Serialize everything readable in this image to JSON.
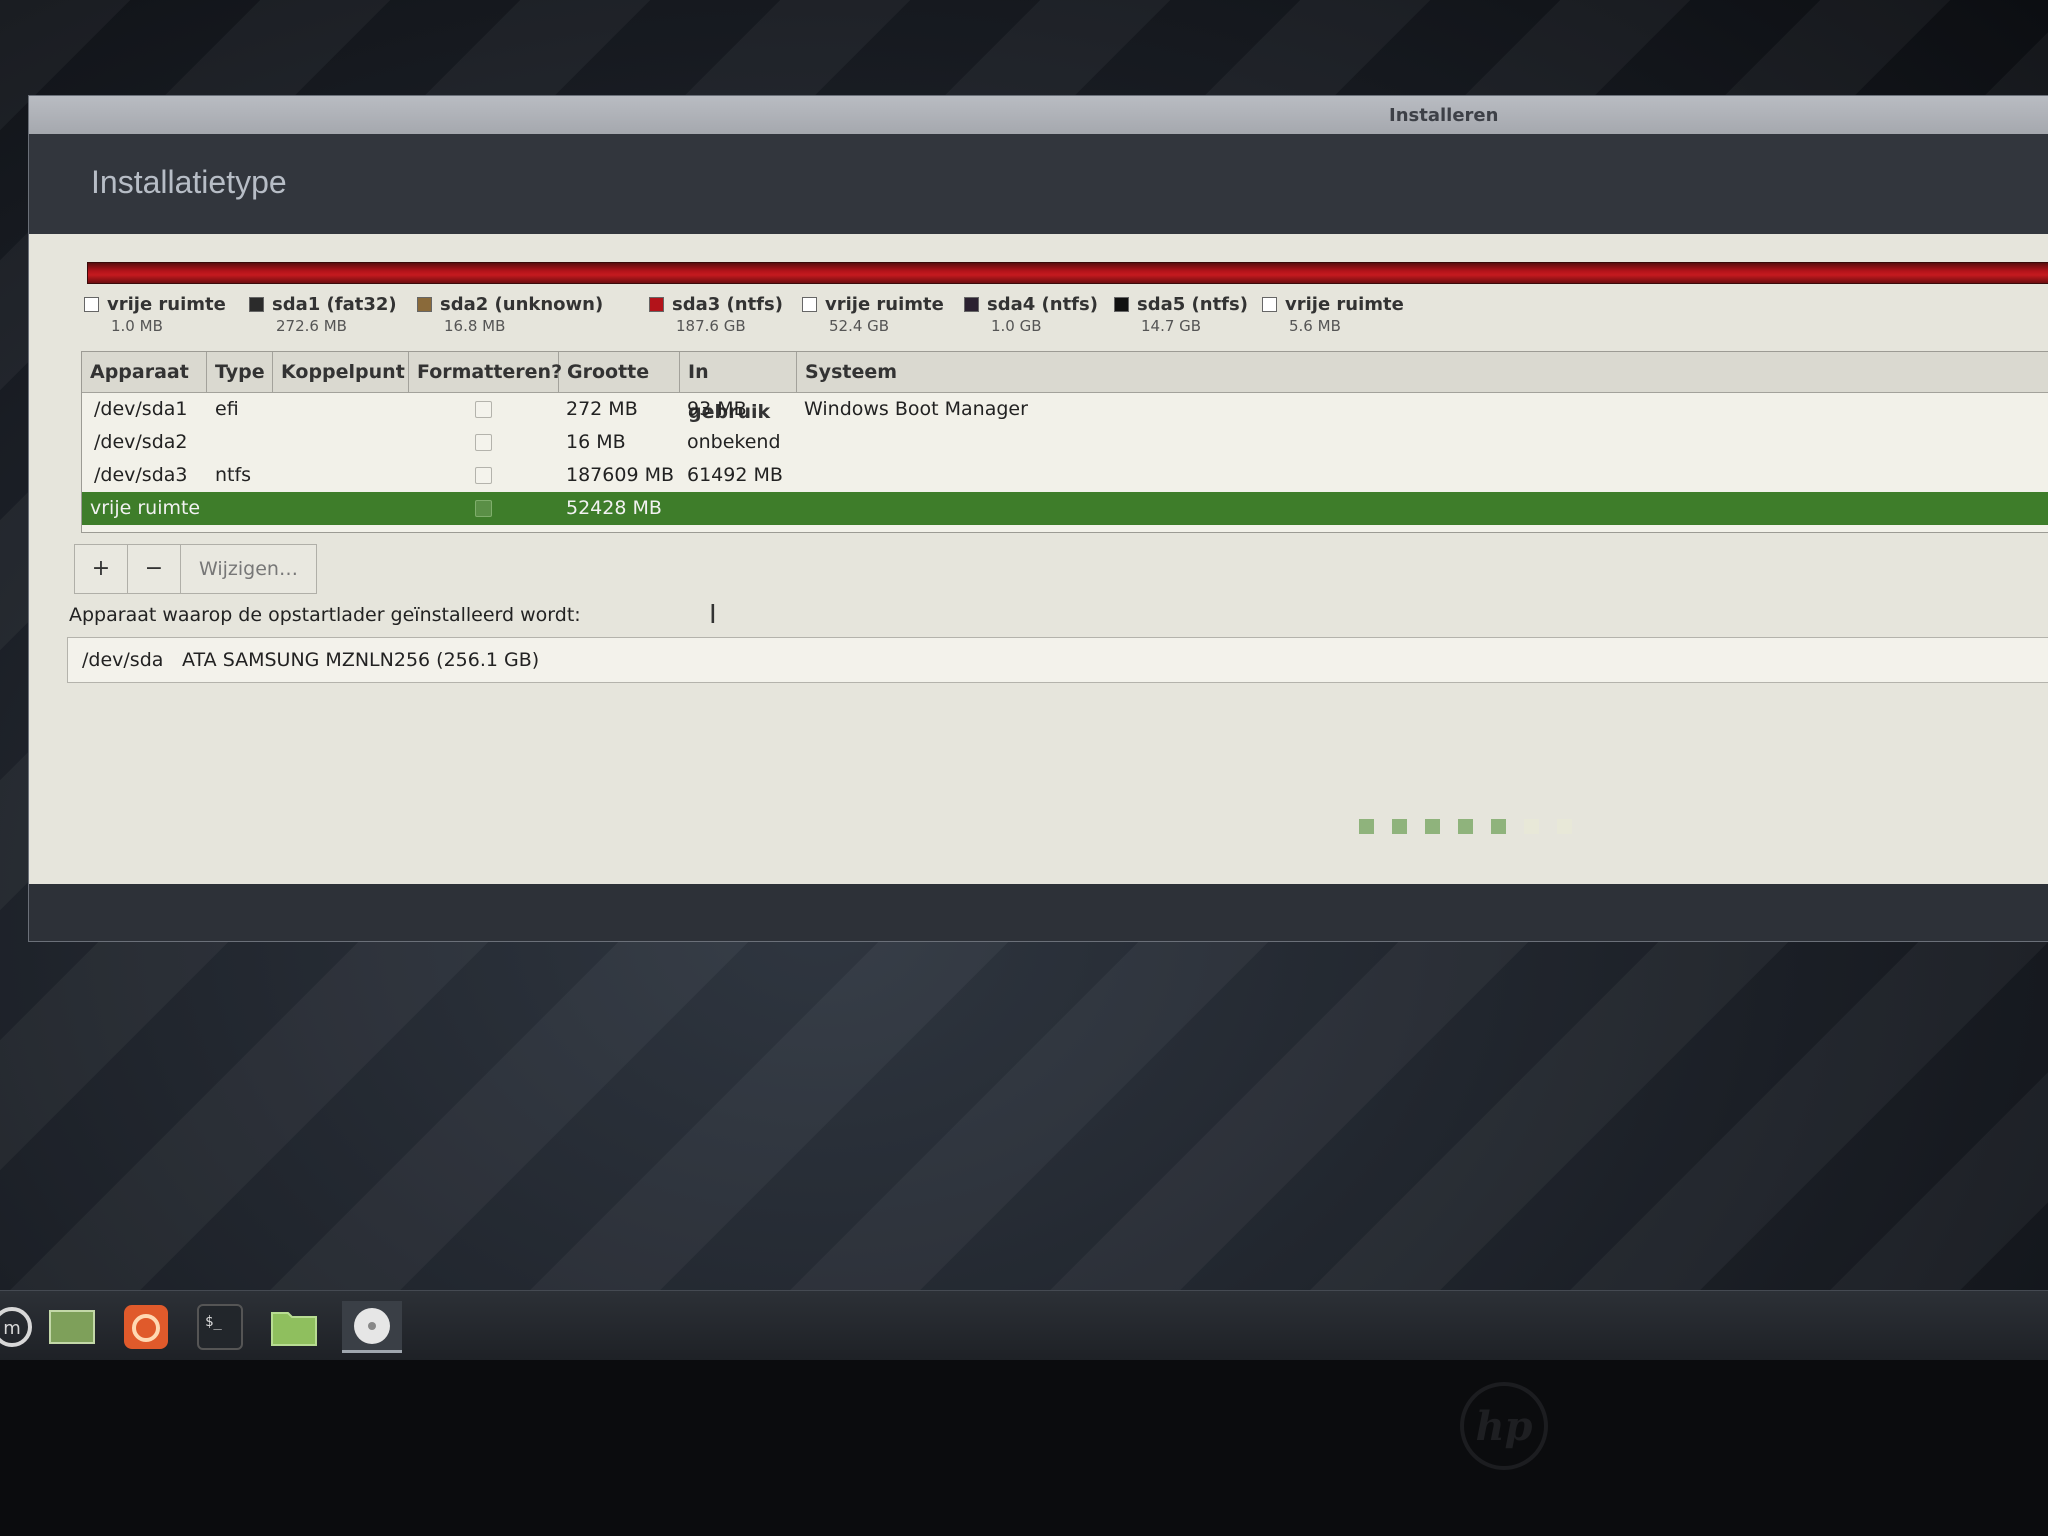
{
  "window": {
    "title": "Installeren"
  },
  "page_title": "Installatietype",
  "legend": [
    {
      "name": "vrije ruimte",
      "size": "1.0 MB",
      "color": "#ffffff"
    },
    {
      "name": "sda1 (fat32)",
      "size": "272.6 MB",
      "color": "#2b2b2b"
    },
    {
      "name": "sda2 (unknown)",
      "size": "16.8 MB",
      "color": "#8a6a3a"
    },
    {
      "name": "sda3 (ntfs)",
      "size": "187.6 GB",
      "color": "#b3131a"
    },
    {
      "name": "vrije ruimte",
      "size": "52.4 GB",
      "color": "#ffffff"
    },
    {
      "name": "sda4 (ntfs)",
      "size": "1.0 GB",
      "color": "#2b2130"
    },
    {
      "name": "sda5 (ntfs)",
      "size": "14.7 GB",
      "color": "#111111"
    },
    {
      "name": "vrije ruimte",
      "size": "5.6 MB",
      "color": "#ffffff"
    }
  ],
  "table": {
    "headers": [
      "Apparaat",
      "Type",
      "Koppelpunt",
      "Formatteren?",
      "Grootte",
      "In gebruik",
      "Systeem"
    ],
    "rows": [
      {
        "device": "/dev/sda1",
        "type": "efi",
        "mount": "",
        "size": "272 MB",
        "used": "93 MB",
        "system": "Windows Boot Manager"
      },
      {
        "device": "/dev/sda2",
        "type": "",
        "mount": "",
        "size": "16 MB",
        "used": "onbekend",
        "system": ""
      },
      {
        "device": "/dev/sda3",
        "type": "ntfs",
        "mount": "",
        "size": "187609 MB",
        "used": "61492 MB",
        "system": ""
      },
      {
        "device": "vrije ruimte",
        "type": "",
        "mount": "",
        "size": "52428 MB",
        "used": "",
        "system": ""
      }
    ]
  },
  "buttons": {
    "add": "+",
    "remove": "−",
    "edit": "Wijzigen…"
  },
  "bootloader": {
    "label": "Apparaat waarop de opstartlader geïnstalleerd wordt:",
    "device": "/dev/sda",
    "description": "ATA SAMSUNG MZNLN256 (256.1 GB)"
  },
  "progress": {
    "total_steps": 7,
    "current_step": 6
  },
  "taskbar": {
    "icons": [
      "mint-menu-icon",
      "show-desktop-icon",
      "firefox-icon",
      "terminal-icon",
      "files-icon",
      "installer-disc-icon"
    ]
  },
  "bezel": {
    "logo": "hp"
  },
  "colors": {
    "selected_row": "#3e7d2a",
    "partition_bar": "#b3131a",
    "progress_dot": "#8fb37c"
  }
}
